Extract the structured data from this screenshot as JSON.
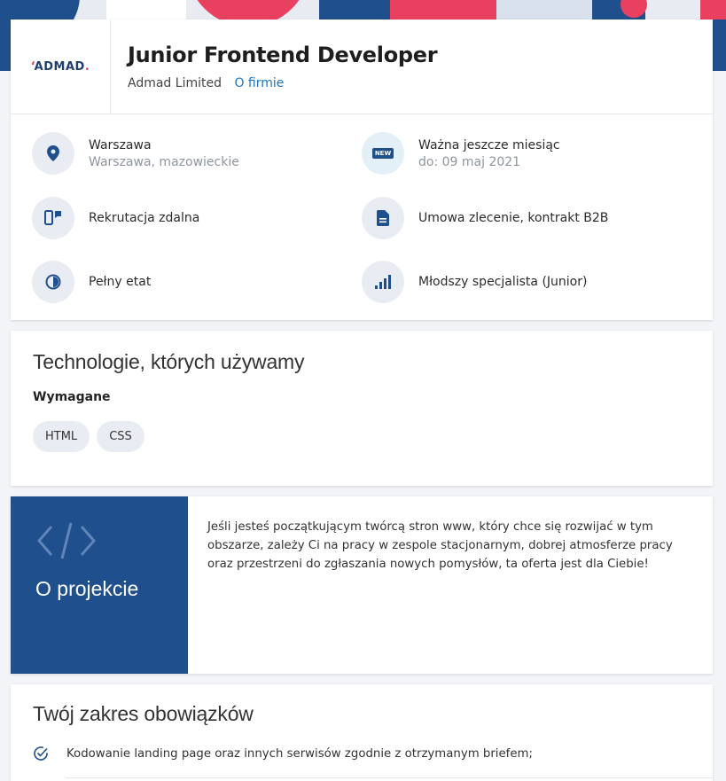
{
  "company": {
    "logo_text_a": "ADMAD",
    "logo_text_b": ".",
    "name": "Admad Limited",
    "about_link": "O firmie"
  },
  "job": {
    "title": "Junior Frontend Developer"
  },
  "info": {
    "location_main": "Warszawa",
    "location_sub": "Warszawa, mazowieckie",
    "validity_main": "Ważna jeszcze miesiąc",
    "validity_sub": "do: 09 maj 2021",
    "recruitment": "Rekrutacja zdalna",
    "contract": "Umowa zlecenie, kontrakt B2B",
    "worktime": "Pełny etat",
    "level": "Młodszy specjalista (Junior)",
    "new_badge": "NEW"
  },
  "technologies": {
    "title": "Technologie, których używamy",
    "required_label": "Wymagane",
    "required": [
      "HTML",
      "CSS"
    ]
  },
  "project": {
    "title": "O projekcie",
    "description": "Jeśli jesteś początkującym twórcą stron www, który chce się rozwijać w tym obszarze, zależy Ci na pracy w zespole stacjonarnym, dobrej atmosferze pracy oraz przestrzeni do zgłaszania nowych pomysłów, ta oferta jest dla Ciebie!"
  },
  "duties": {
    "title": "Twój zakres obowiązków",
    "items": [
      "Kodowanie landing page oraz innych serwisów zgodnie z otrzymanym briefem;"
    ]
  },
  "colors": {
    "brand_blue": "#1f4f8c",
    "accent_pink": "#e8405e",
    "link_blue": "#1d74c0"
  }
}
